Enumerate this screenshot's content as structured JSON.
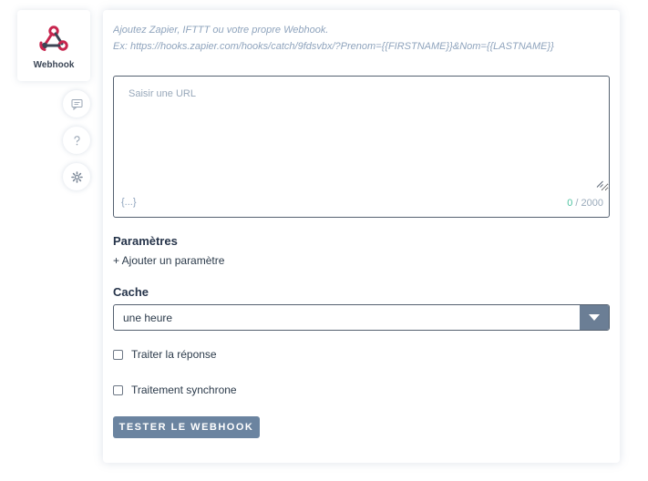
{
  "block": {
    "label": "Webhook",
    "icon": "webhook-icon",
    "icon_colors": {
      "primary": "#c7254e",
      "secondary": "#3d4454"
    }
  },
  "side_buttons": [
    {
      "icon": "comment-icon"
    },
    {
      "icon": "help-icon"
    },
    {
      "icon": "gear-icon"
    }
  ],
  "panel": {
    "hint_line1": "Ajoutez Zapier, IFTTT ou votre propre Webhook.",
    "hint_line2": "Ex: https://hooks.zapier.com/hooks/catch/9fdsvbx/?Prenom={{FIRSTNAME}}&Nom={{LASTNAME}}",
    "url_input": {
      "value": "",
      "placeholder": "Saisir une URL"
    },
    "variable_button": "{...}",
    "counter_current": "0",
    "counter_max": "/ 2000",
    "params_title": "Paramètres",
    "add_param_label": "+ Ajouter un paramètre",
    "cache_title": "Cache",
    "cache_selected": "une heure",
    "checkbox_process_response": {
      "label": "Traiter la réponse",
      "checked": false
    },
    "checkbox_sync": {
      "label": "Traitement synchrone",
      "checked": false
    },
    "test_button": "TESTER LE WEBHOOK"
  },
  "colors": {
    "button_bg": "#6b84a0",
    "counter_accent": "#4fc3a1",
    "hint_text": "#8fa4bd"
  }
}
